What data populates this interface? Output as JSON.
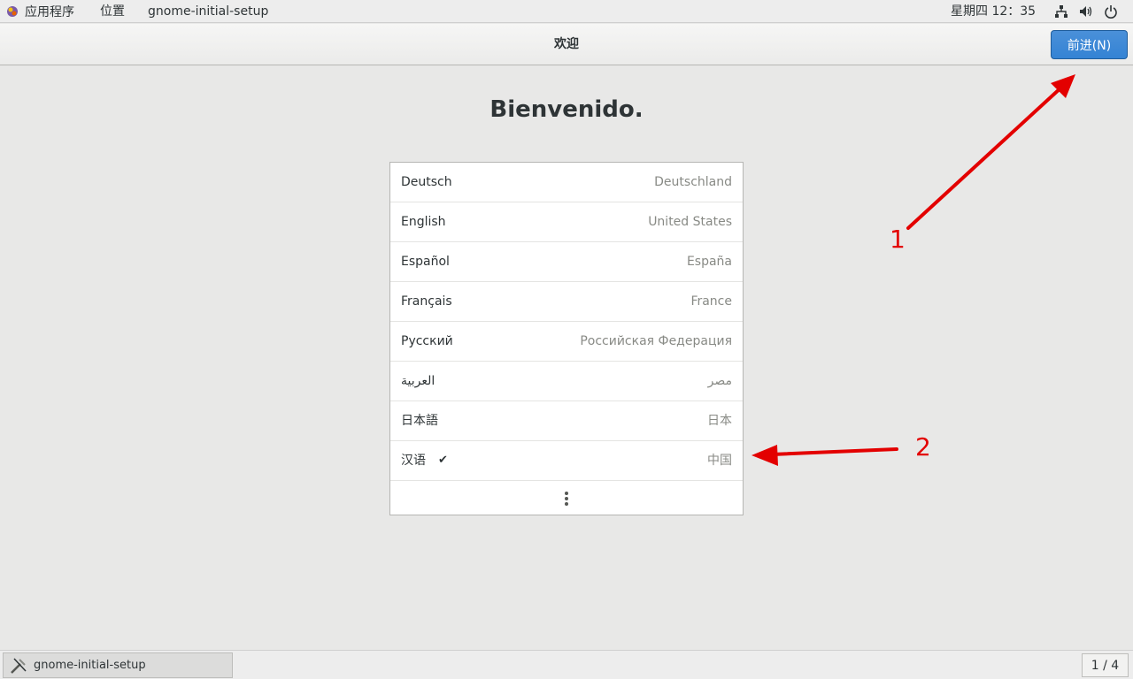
{
  "topbar": {
    "apps_label": "应用程序",
    "places_label": "位置",
    "app_name": "gnome-initial-setup",
    "clock": "星期四 12：35",
    "icons": [
      "network-icon",
      "volume-icon",
      "power-icon"
    ]
  },
  "headerbar": {
    "title": "欢迎",
    "next_label": "前进(N)"
  },
  "main": {
    "welcome": "Bienvenido.",
    "languages": [
      {
        "lang": "Deutsch",
        "country": "Deutschland",
        "selected": false
      },
      {
        "lang": "English",
        "country": "United States",
        "selected": false
      },
      {
        "lang": "Español",
        "country": "España",
        "selected": false
      },
      {
        "lang": "Français",
        "country": "France",
        "selected": false
      },
      {
        "lang": "Русский",
        "country": "Российская Федерация",
        "selected": false
      },
      {
        "lang": "العربية",
        "country": "مصر",
        "selected": false
      },
      {
        "lang": "日本語",
        "country": "日本",
        "selected": false
      },
      {
        "lang": "汉语",
        "country": "中国",
        "selected": true
      }
    ],
    "check_glyph": "✔"
  },
  "annotations": {
    "label1": "1",
    "label2": "2",
    "color": "#e30000"
  },
  "taskbar": {
    "task_label": "gnome-initial-setup",
    "pager": "1 / 4"
  }
}
